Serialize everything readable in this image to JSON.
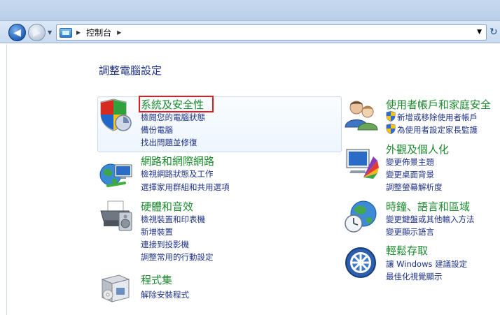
{
  "address_bar": {
    "path": "控制台",
    "back_label": "◀",
    "forward_label": "▶"
  },
  "page_title": "調整電腦設定",
  "categories_left": [
    {
      "title": "系統及安全性",
      "icon": "shield-icon",
      "links": [
        "檢閱您的電腦狀態",
        "備份電腦",
        "找出問題並修復"
      ]
    },
    {
      "title": "網路和網際網路",
      "icon": "network-globe-icon",
      "links": [
        "檢視網路狀態及工作",
        "選擇家用群組和共用選項"
      ]
    },
    {
      "title": "硬體和音效",
      "icon": "printer-icon",
      "links": [
        "檢視裝置和印表機",
        "新增裝置",
        "連接到投影機",
        "調整常用的行動設定"
      ]
    },
    {
      "title": "程式集",
      "icon": "programs-box-icon",
      "links": [
        "解除安裝程式"
      ]
    }
  ],
  "categories_right": [
    {
      "title": "使用者帳戶和家庭安全",
      "icon": "users-icon",
      "links": [
        "新增或移除使用者帳戶",
        "為使用者設定家長監護"
      ]
    },
    {
      "title": "外觀及個人化",
      "icon": "monitor-colors-icon",
      "links": [
        "變更佈景主題",
        "變更桌面背景",
        "調整螢幕解析度"
      ]
    },
    {
      "title": "時鐘、語言和區域",
      "icon": "globe-clock-icon",
      "links": [
        "變更鍵盤或其他輸入方法",
        "變更顯示語言"
      ]
    },
    {
      "title": "輕鬆存取",
      "icon": "ease-of-access-icon",
      "links": [
        "讓 Windows 建議設定",
        "最佳化視覺顯示"
      ]
    }
  ],
  "colors": {
    "category_title": "#1c8a2e",
    "link": "#1e3287",
    "highlight_frame": "#e11b22"
  }
}
